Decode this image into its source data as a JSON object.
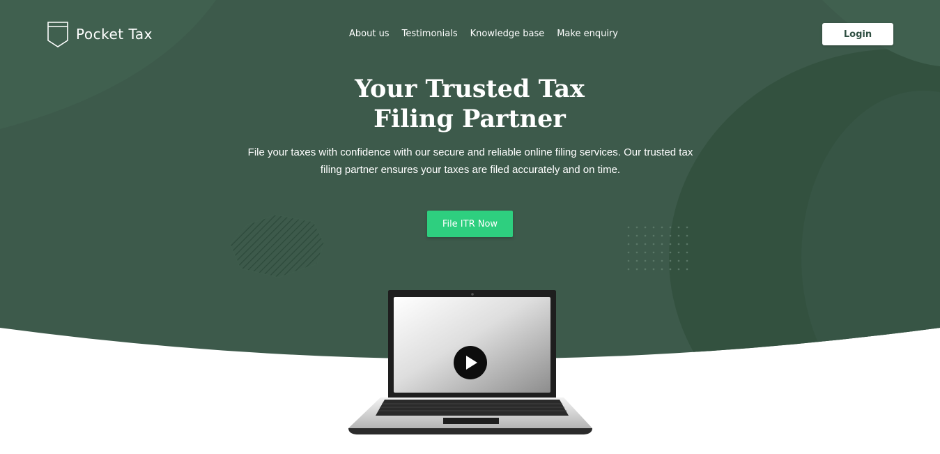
{
  "brand": {
    "name": "Pocket Tax",
    "logo_icon": "pocket-shield-icon"
  },
  "nav": {
    "items": [
      {
        "label": "About us"
      },
      {
        "label": "Testimonials"
      },
      {
        "label": "Knowledge base"
      },
      {
        "label": "Make enquiry"
      }
    ]
  },
  "header": {
    "login_label": "Login"
  },
  "hero": {
    "title_line1": "Your Trusted Tax",
    "title_line2": "Filing Partner",
    "subtitle_line1": "File your taxes with confidence with our secure and reliable online filing services. Our trusted tax",
    "subtitle_line2": "filing partner ensures your taxes are filed accurately and on time.",
    "cta_label": "File ITR Now"
  },
  "video": {
    "play_icon": "play-icon"
  },
  "colors": {
    "hero_bg": "#3d5a4b",
    "hero_bg_dark": "#33513f",
    "cta": "#2ecf7f",
    "text_light": "#ffffff",
    "brand_dark": "#2f4f42"
  }
}
